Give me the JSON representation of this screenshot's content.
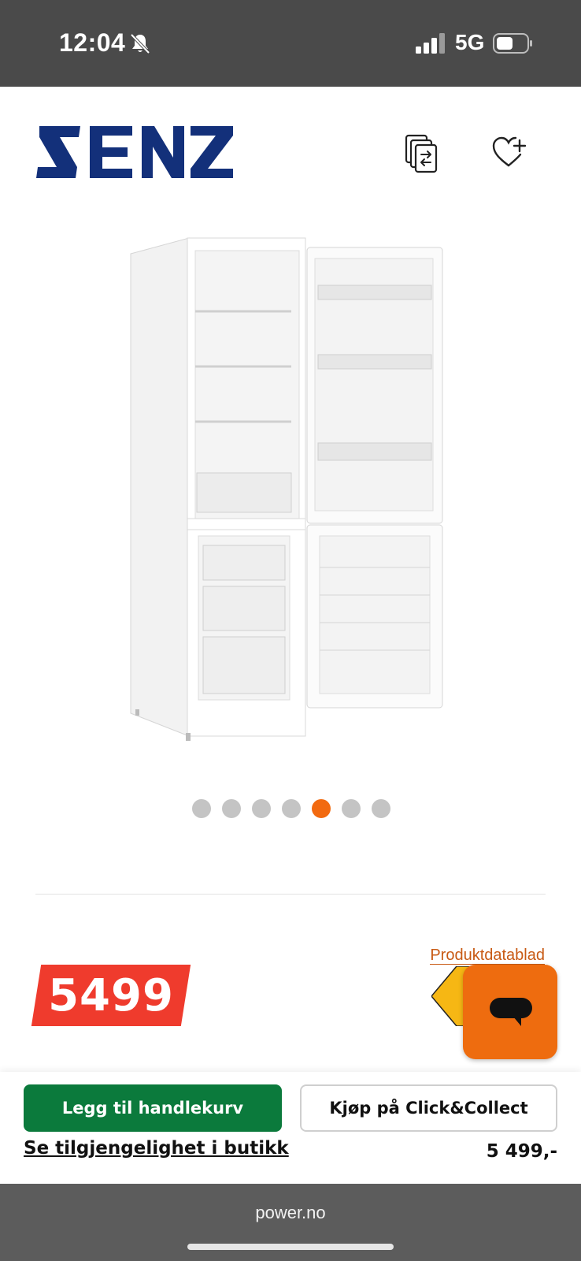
{
  "status_bar": {
    "time": "12:04",
    "network": "5G",
    "icons": [
      "bell-muted-icon",
      "signal-icon",
      "battery-icon"
    ]
  },
  "header": {
    "brand": "SENZ",
    "icons": [
      "compare-icon",
      "wishlist-icon"
    ],
    "brand_color": "#13307a"
  },
  "gallery": {
    "total_images": 7,
    "active_index": 4,
    "active_color": "#f26a10",
    "inactive_color": "#c4c4c4"
  },
  "price": {
    "value": "5499",
    "color": "#ef3b2d"
  },
  "links": {
    "datasheet": "Produktdatablad"
  },
  "chat": {
    "icon": "chat-bubble-icon",
    "color": "#ee6c0f"
  },
  "action_bar": {
    "add_to_cart": "Legg til handlekurv",
    "click_collect": "Kjøp på Click&Collect",
    "availability": "Se tilgjengelighet i butikk",
    "price": "5 499,-"
  },
  "browser": {
    "url": "power.no"
  }
}
